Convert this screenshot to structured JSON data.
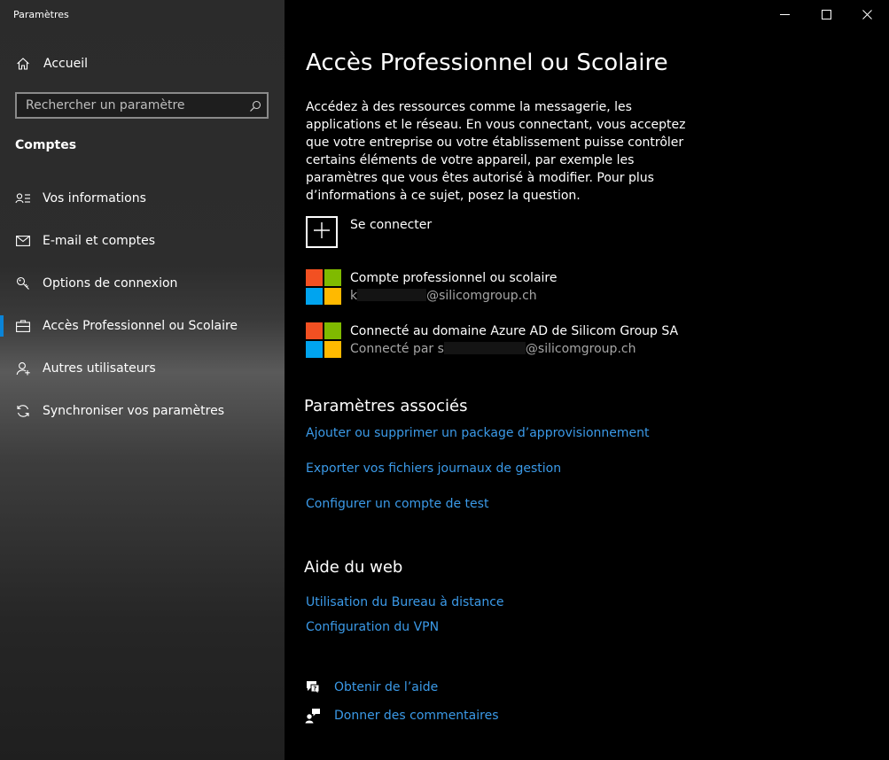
{
  "app": {
    "title": "Paramètres"
  },
  "window_controls": {
    "minimize": "minimize-icon",
    "maximize": "maximize-icon",
    "close": "close-icon"
  },
  "sidebar": {
    "home_label": "Accueil",
    "search_placeholder": "Rechercher un paramètre",
    "section_title": "Comptes",
    "items": [
      {
        "label": "Vos informations",
        "icon": "person-card-icon"
      },
      {
        "label": "E-mail et comptes",
        "icon": "mail-icon"
      },
      {
        "label": "Options de connexion",
        "icon": "key-icon"
      },
      {
        "label": "Accès Professionnel ou Scolaire",
        "icon": "briefcase-icon",
        "active": true
      },
      {
        "label": "Autres utilisateurs",
        "icon": "person-add-icon"
      },
      {
        "label": "Synchroniser vos paramètres",
        "icon": "sync-icon"
      }
    ],
    "accent_color": "#0a84d8"
  },
  "main": {
    "title": "Accès Professionnel ou Scolaire",
    "intro": "Accédez à des ressources comme la messagerie, les applications et le réseau. En vous connectant, vous acceptez que votre entreprise ou votre établissement puisse contrôler certains éléments de votre appareil, par exemple les paramètres que vous êtes autorisé à modifier. Pour plus d’informations à ce sujet, posez la question.",
    "connect_label": "Se connecter",
    "accounts": [
      {
        "title": "Compte professionnel ou scolaire",
        "sub_prefix": "k",
        "sub_suffix": "@silicomgroup.ch"
      },
      {
        "title": "Connecté au domaine Azure AD de Silicom Group SA",
        "sub_prefix": "Connecté par s",
        "sub_suffix": "@silicomgroup.ch"
      }
    ],
    "related": {
      "heading": "Paramètres associés",
      "links": [
        "Ajouter ou supprimer un package d’approvisionnement",
        "Exporter vos fichiers journaux de gestion",
        "Configurer un compte de test"
      ]
    },
    "web_help": {
      "heading": "Aide du web",
      "links": [
        "Utilisation du Bureau à distance",
        "Configuration du VPN"
      ]
    },
    "help": {
      "get_help": "Obtenir de l’aide",
      "feedback": "Donner des commentaires"
    },
    "link_color": "#3b9ae8",
    "logo_colors": [
      "#f25022",
      "#7fba00",
      "#00a4ef",
      "#ffb900"
    ]
  }
}
